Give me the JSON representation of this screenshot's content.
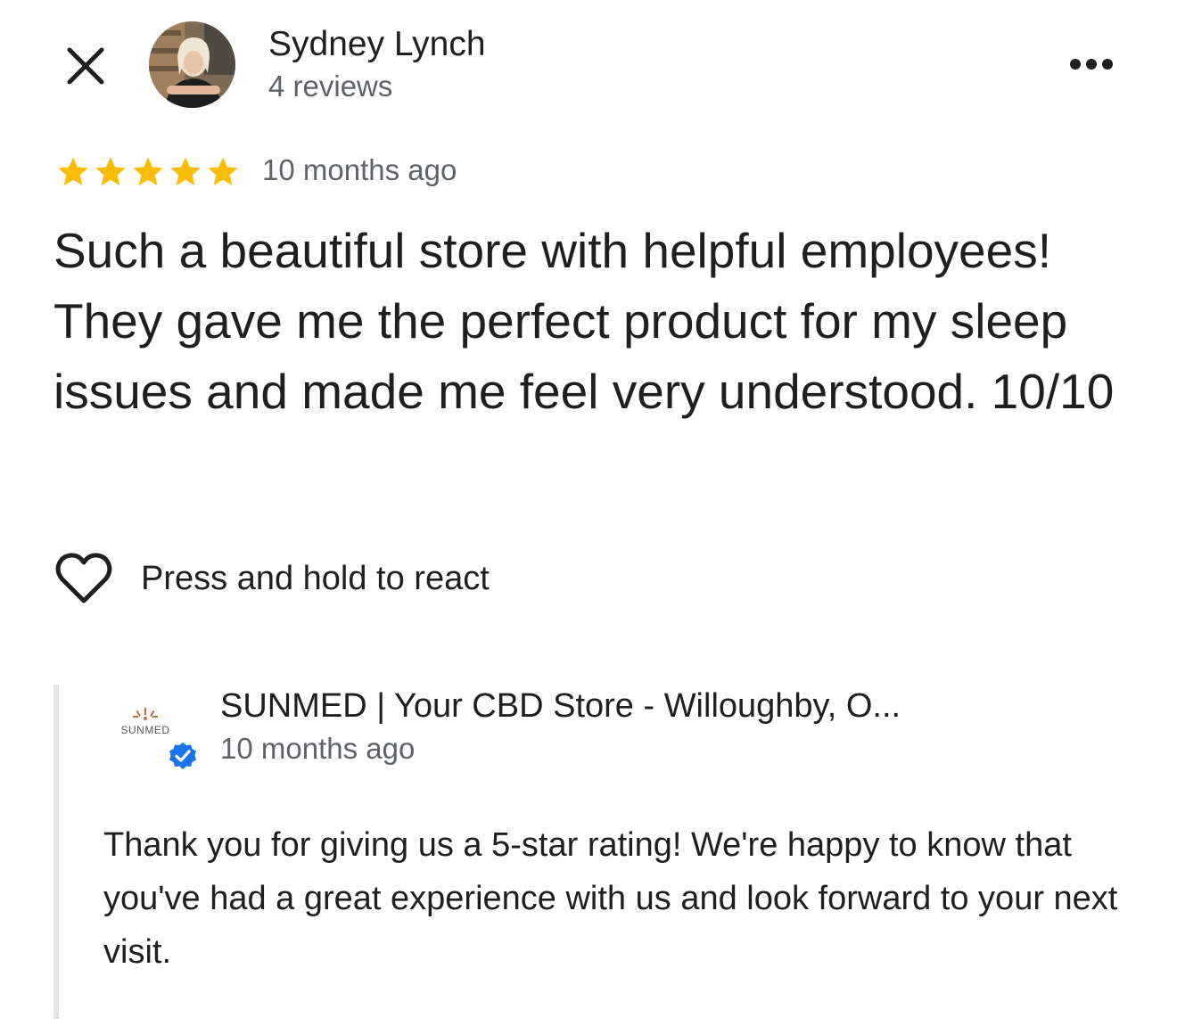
{
  "header": {
    "close_icon": "close-icon",
    "more_icon": "more-horizontal-icon"
  },
  "reviewer": {
    "name": "Sydney Lynch",
    "review_count": "4 reviews",
    "avatar_icon": "profile-photo"
  },
  "review": {
    "rating": 5,
    "rating_max": 5,
    "star_color": "#fbbc04",
    "date": "10 months ago",
    "text": "Such a beautiful store with helpful employees! They gave me the perfect product for my sleep issues and made me feel very understood. 10/10"
  },
  "reaction": {
    "icon": "heart-outline-icon",
    "label": "Press and hold to react"
  },
  "owner_response": {
    "logo_text": "SUNMED",
    "verified_icon": "verified-check-icon",
    "verified_color": "#1a73e8",
    "name": "SUNMED | Your CBD Store - Willoughby, O...",
    "date": "10 months ago",
    "text": "Thank you for giving us a 5-star rating! We're happy to know that you've had a great experience with us and look forward to your next visit."
  }
}
